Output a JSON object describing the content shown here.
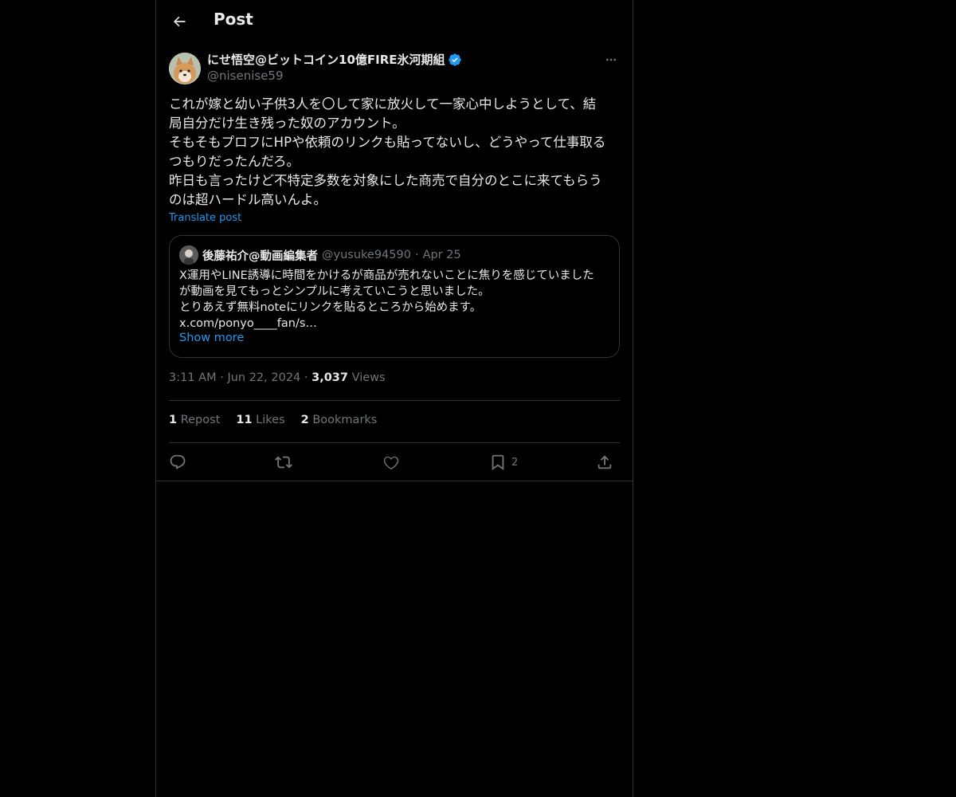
{
  "header": {
    "title": "Post",
    "back_icon": "arrow-left-icon"
  },
  "author": {
    "display_name": "にせ悟空@ビットコイン10億FIRE氷河期組",
    "handle": "@nisenise59",
    "verified": true,
    "verified_color": "#1d9bf0"
  },
  "post": {
    "text": "これが嫁と幼い子供3人を〇して家に放火して一家心中しようとして、結\n局自分だけ生き残った奴のアカウント。\nそもそもプロフにHPや依頼のリンクも貼ってないし、どうやって仕事取る\nつもりだったんだろ。\n昨日も言ったけど不特定多数を対象にした商売で自分のとこに来てもらう\nのは超ハードル高いんよ。",
    "translate_label": "Translate post"
  },
  "quote": {
    "display_name": "後藤祐介@動画編集者",
    "handle": "@yusuke94590",
    "separator": "·",
    "date": "Apr 25",
    "text": "X運用やLINE誘導に時間をかけるが商品が売れないことに焦りを感じていました\nが動画を見てもっとシンプルに考えていこうと思いました。\nとりあえず無料noteにリンクを貼るところから始めます。\nx.com/ponyo____fan/s…",
    "show_more": "Show more"
  },
  "meta": {
    "time": "3:11 AM",
    "separator": "·",
    "date": "Jun 22, 2024",
    "views_count": "3,037",
    "views_label": "Views"
  },
  "stats": {
    "reposts_count": "1",
    "reposts_label": "Repost",
    "likes_count": "11",
    "likes_label": "Likes",
    "bookmarks_count": "2",
    "bookmarks_label": "Bookmarks"
  },
  "actions": {
    "reply_icon": "reply-icon",
    "repost_icon": "repost-icon",
    "like_icon": "heart-icon",
    "bookmark_icon": "bookmark-icon",
    "bookmark_count": "2",
    "share_icon": "share-icon"
  },
  "colors": {
    "background": "#000000",
    "text": "#e7e9ea",
    "muted": "#71767b",
    "accent": "#1d9bf0",
    "border": "#2f3336"
  }
}
